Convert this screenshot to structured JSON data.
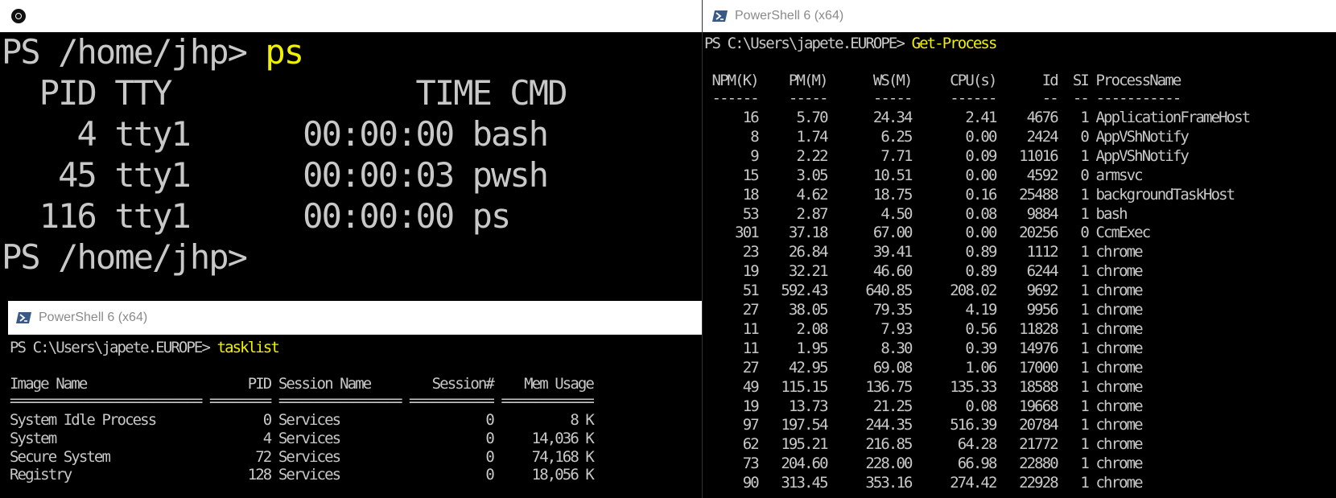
{
  "bash_window": {
    "icon": "ubuntu-icon",
    "prompt": "PS /home/jhp>",
    "command": "ps",
    "header": "  PID TTY             TIME CMD",
    "rows": [
      "    4 tty1      00:00:00 bash",
      "   45 tty1      00:00:03 pwsh",
      "  116 tty1      00:00:00 ps"
    ],
    "final_prompt": "PS /home/jhp>"
  },
  "tasklist_window": {
    "title": "PowerShell 6 (x64)",
    "icon": "powershell-icon",
    "prompt": "PS C:\\Users\\japete.EUROPE>",
    "command": "tasklist",
    "header": "Image Name                     PID Session Name        Session#    Mem Usage",
    "separator": "========================= ======== ================ =========== ============",
    "rows": [
      "System Idle Process              0 Services                   0          8 K",
      "System                           4 Services                   0     14,036 K",
      "Secure System                   72 Services                   0     74,168 K",
      "Registry                       128 Services                   0     18,056 K"
    ]
  },
  "getprocess_window": {
    "title": "PowerShell 6 (x64)",
    "icon": "powershell-icon",
    "prompt": "PS C:\\Users\\japete.EUROPE>",
    "command": "Get-Process",
    "header": " NPM(K)    PM(M)      WS(M)     CPU(s)      Id  SI ProcessName",
    "separator": " ------    -----      -----     ------      --  -- -----------",
    "rows": [
      "     16     5.70      24.34       2.41    4676   1 ApplicationFrameHost",
      "      8     1.74       6.25       0.00    2424   0 AppVShNotify",
      "      9     2.22       7.71       0.09   11016   1 AppVShNotify",
      "     15     3.05      10.51       0.00    4592   0 armsvc",
      "     18     4.62      18.75       0.16   25488   1 backgroundTaskHost",
      "     53     2.87       4.50       0.08    9884   1 bash",
      "    301    37.18      67.00       0.00   20256   0 CcmExec",
      "     23    26.84      39.41       0.89    1112   1 chrome",
      "     19    32.21      46.60       0.89    6244   1 chrome",
      "     51   592.43     640.85     208.02    9692   1 chrome",
      "     27    38.05      79.35       4.19    9956   1 chrome",
      "     11     2.08       7.93       0.56   11828   1 chrome",
      "     11     1.95       8.30       0.39   14976   1 chrome",
      "     27    42.95      69.08       1.06   17000   1 chrome",
      "     49   115.15     136.75     135.33   18588   1 chrome",
      "     19    13.73      21.25       0.08   19668   1 chrome",
      "     97   197.54     244.35     516.39   20784   1 chrome",
      "     62   195.21     216.85      64.28   21772   1 chrome",
      "     73   204.60     228.00      66.98   22880   1 chrome",
      "     90   313.45     353.16     274.42   22928   1 chrome"
    ]
  }
}
